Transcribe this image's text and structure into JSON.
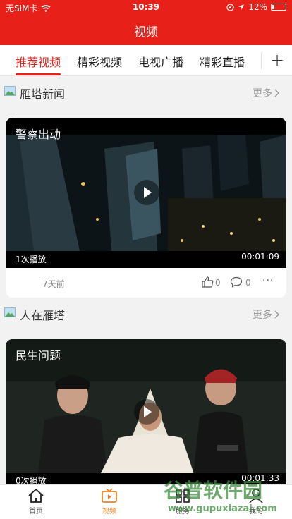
{
  "status_bar": {
    "carrier": "无SIM卡",
    "time": "10:39",
    "battery": "12%"
  },
  "nav": {
    "title": "视频"
  },
  "tabs": [
    {
      "label": "推荐视频",
      "active": true
    },
    {
      "label": "精彩视频",
      "active": false
    },
    {
      "label": "电视广播",
      "active": false
    },
    {
      "label": "精彩直播",
      "active": false
    }
  ],
  "sections": [
    {
      "title": "雁塔新闻",
      "more": "更多",
      "video": {
        "title": "警察出动",
        "plays": "1次播放",
        "duration": "00:01:09",
        "time_ago": "7天前",
        "likes": "0",
        "comments": "0"
      }
    },
    {
      "title": "人在雁塔",
      "more": "更多",
      "video": {
        "title": "民生问题",
        "plays": "0次播放",
        "duration": "00:01:33"
      }
    }
  ],
  "bottom_nav": [
    {
      "label": "首页",
      "icon": "home-icon"
    },
    {
      "label": "视频",
      "icon": "video-icon",
      "active": true
    },
    {
      "label": "服务",
      "icon": "service-icon"
    },
    {
      "label": "我的",
      "icon": "profile-icon"
    }
  ],
  "watermark": {
    "text": "谷普软件园",
    "url": "www.gupuxiazai.com"
  },
  "colors": {
    "brand": "#e8201a",
    "active_bottom": "#f08020"
  }
}
